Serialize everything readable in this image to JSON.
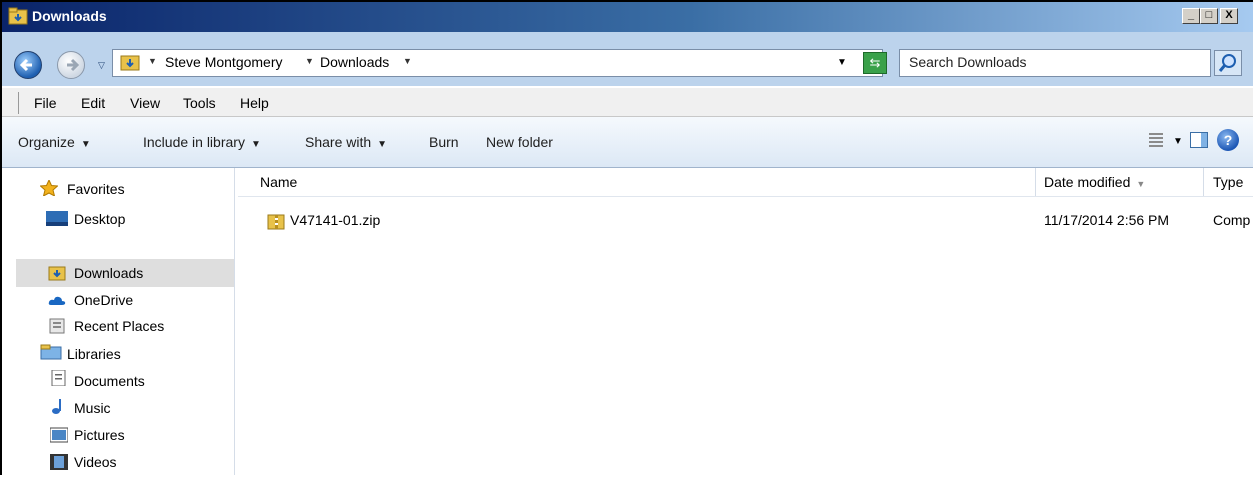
{
  "window": {
    "title": "Downloads"
  },
  "caption_buttons": {
    "minimize": "_",
    "maximize": "□",
    "close": "X"
  },
  "address": {
    "crumbs": [
      "Steve Montgomery",
      "Downloads"
    ],
    "search_placeholder": "Search Downloads"
  },
  "menu": [
    "File",
    "Edit",
    "View",
    "Tools",
    "Help"
  ],
  "toolbar": {
    "organize": "Organize",
    "include_in_library": "Include in library",
    "share_with": "Share with",
    "burn": "Burn",
    "new_folder": "New folder"
  },
  "nav": {
    "favorites": {
      "label": "Favorites",
      "items": [
        "Desktop",
        "Downloads",
        "OneDrive",
        "Recent Places"
      ]
    },
    "libraries": {
      "label": "Libraries",
      "items": [
        "Documents",
        "Music",
        "Pictures",
        "Videos"
      ]
    }
  },
  "columns": {
    "name": "Name",
    "date_modified": "Date modified",
    "type": "Type"
  },
  "files": [
    {
      "name": "V47141-01.zip",
      "date_modified": "11/17/2014 2:56 PM",
      "type": "Comp"
    }
  ],
  "colors": {
    "accent": "#3a6ea5",
    "selection": "#dedede"
  }
}
